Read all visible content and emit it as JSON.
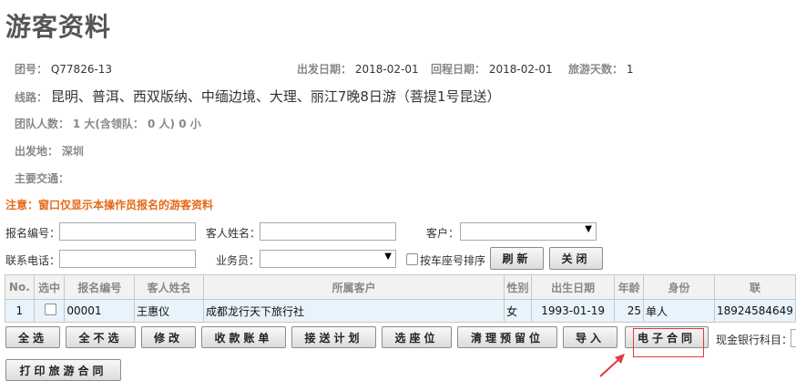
{
  "page_title": "游客资料",
  "group_info": {
    "group_no_label": "团号：",
    "group_no": "Q77826-13",
    "depart_label": "出发日期：",
    "depart_date": "2018-02-01",
    "return_label": "回程日期：",
    "return_date": "2018-02-01",
    "days_label": "旅游天数：",
    "days": "1",
    "route_label": "线路：",
    "route": "昆明、普洱、西双版纳、中缅边境、大理、丽江7晚8日游（菩提1号昆送）",
    "team_label": "团队人数：",
    "team_count": "1 大(含领队：  0 人) 0 小",
    "origin_label": "出发地：",
    "origin": "深圳",
    "transport_label": "主要交通："
  },
  "notice": "注意：窗口仅显示本操作员报名的游客资料",
  "filters": {
    "booking_no_label": "报名编号：",
    "booking_no_value": "",
    "guest_name_label": "客人姓名：",
    "guest_name_value": "",
    "customer_label": "客户：",
    "customer_value": "",
    "phone_label": "联系电话：",
    "phone_value": "",
    "salesman_label": "业务员：",
    "salesman_value": "",
    "sort_label": "按车座号排序",
    "refresh_label": "刷新",
    "close_label": "关闭"
  },
  "table": {
    "headers": [
      "No.",
      "选中",
      "报名编号",
      "客人姓名",
      "所属客户",
      "性别",
      "出生日期",
      "年龄",
      "身份",
      "联"
    ],
    "rows": [
      {
        "no": "1",
        "booking_no": "00001",
        "name": "王惠仪",
        "customer": "成都龙行天下旅行社",
        "gender": "女",
        "birth": "1993-01-19",
        "age": "25",
        "identity": "单人",
        "phone": "18924584649"
      }
    ]
  },
  "actions": {
    "select_all": "全选",
    "deselect_all": "全不选",
    "edit": "修改",
    "receipt": "收款账单",
    "shuttle": "接送计划",
    "seat": "选座位",
    "clear_reserved": "清理预留位",
    "import": "导入",
    "e_contract": "电子合同",
    "cash_account_label": "现金银行科目：",
    "print_contract": "打印旅游合同"
  },
  "colors": {
    "notice": "#e56a1a",
    "highlight": "#e23b3b",
    "row_bg": "#e8f3fb"
  }
}
